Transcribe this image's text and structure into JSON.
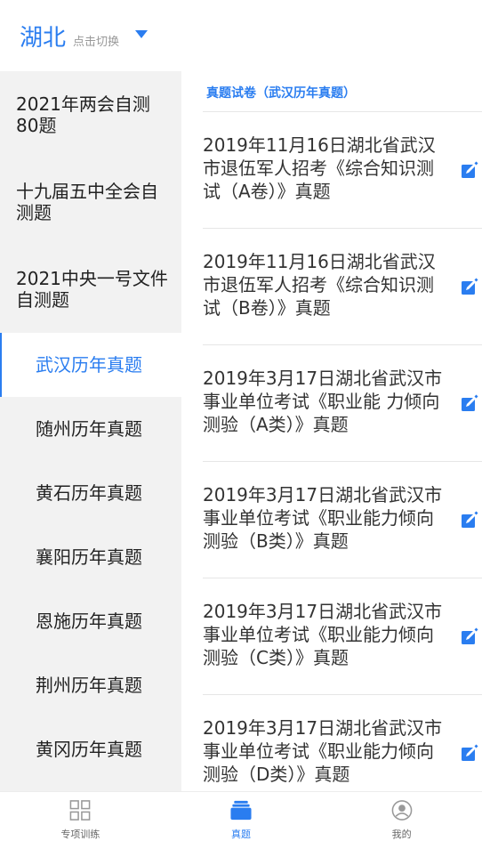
{
  "header": {
    "region": "湖北",
    "region_hint": "点击切换"
  },
  "sidebar": {
    "items": [
      {
        "label": "2021年两会自测80题"
      },
      {
        "label": "十九届五中全会自测题"
      },
      {
        "label": "2021中央一号文件自测题"
      },
      {
        "label": "武汉历年真题",
        "active": true
      },
      {
        "label": "随州历年真题"
      },
      {
        "label": "黄石历年真题"
      },
      {
        "label": "襄阳历年真题"
      },
      {
        "label": "恩施历年真题"
      },
      {
        "label": "荆州历年真题"
      },
      {
        "label": "黄冈历年真题"
      }
    ]
  },
  "content": {
    "section_title": "真题试卷（武汉历年真题）",
    "papers": [
      {
        "title": "2019年11月16日湖北省武汉市退伍军人招考《综合知识测试（A卷）》真题"
      },
      {
        "title": "2019年11月16日湖北省武汉市退伍军人招考《综合知识测试（B卷）》真题"
      },
      {
        "title": "2019年3月17日湖北省武汉市事业单位考试《职业能 力倾向测验（A类）》真题"
      },
      {
        "title": "2019年3月17日湖北省武汉市事业单位考试《职业能力倾向测验（B类）》真题"
      },
      {
        "title": "2019年3月17日湖北省武汉市事业单位考试《职业能力倾向测验（C类）》真题"
      },
      {
        "title": "2019年3月17日湖北省武汉市事业单位考试《职业能力倾向测验（D类）》真题"
      }
    ]
  },
  "bottom_nav": {
    "items": [
      {
        "label": "专项训练",
        "icon": "grid-icon"
      },
      {
        "label": "真题",
        "icon": "stack-icon",
        "active": true
      },
      {
        "label": "我的",
        "icon": "user-icon"
      }
    ]
  },
  "colors": {
    "accent": "#2a7df0",
    "sidebar_bg": "#f2f2f2",
    "divider": "#e6e6e6"
  }
}
